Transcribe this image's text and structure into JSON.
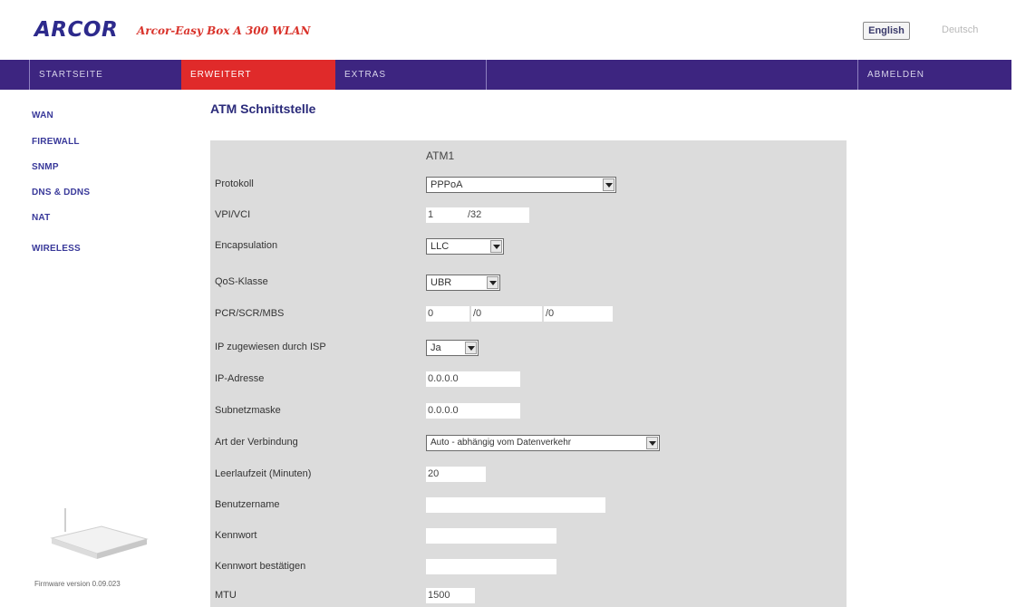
{
  "header": {
    "logo": "ARCOR",
    "product": "Arcor-Easy Box A 300 WLAN",
    "languages": {
      "english": "English",
      "deutsch": "Deutsch"
    }
  },
  "nav": {
    "startseite": "STARTSEITE",
    "erweitert": "ERWEITERT",
    "extras": "EXTRAS",
    "abmelden": "ABMELDEN"
  },
  "sidebar": {
    "items": [
      "WAN",
      "FIREWALL",
      "SNMP",
      "DNS & DDNS",
      "NAT",
      "WIRELESS"
    ],
    "firmware": "Firmware version 0.09.023"
  },
  "main": {
    "title": "ATM Schnittstelle",
    "column_header": "ATM1",
    "labels": {
      "protokoll": "Protokoll",
      "vpivci": "VPI/VCI",
      "encapsulation": "Encapsulation",
      "qos": "QoS-Klasse",
      "pcr": "PCR/SCR/MBS",
      "ip_isp": "IP zugewiesen durch ISP",
      "ip_adresse": "IP-Adresse",
      "subnetzmaske": "Subnetzmaske",
      "art": "Art der Verbindung",
      "leerlauf": "Leerlaufzeit (Minuten)",
      "benutzername": "Benutzername",
      "kennwort": "Kennwort",
      "kennwort_bestaetigen": "Kennwort bestätigen",
      "mtu": "MTU"
    },
    "values": {
      "protokoll": "PPPoA",
      "vpi": "1",
      "vci_sep": "/32",
      "encapsulation": "LLC",
      "qos": "UBR",
      "pcr": "0",
      "scr_sep": "/0",
      "mbs_sep": "/0",
      "ip_isp": "Ja",
      "ip_adresse": "0.0.0.0",
      "subnetzmaske": "0.0.0.0",
      "art": "Auto - abhängig vom Datenverkehr",
      "leerlauf": "20",
      "benutzername": "",
      "kennwort": "",
      "kennwort_bestaetigen": "",
      "mtu": "1500"
    }
  }
}
